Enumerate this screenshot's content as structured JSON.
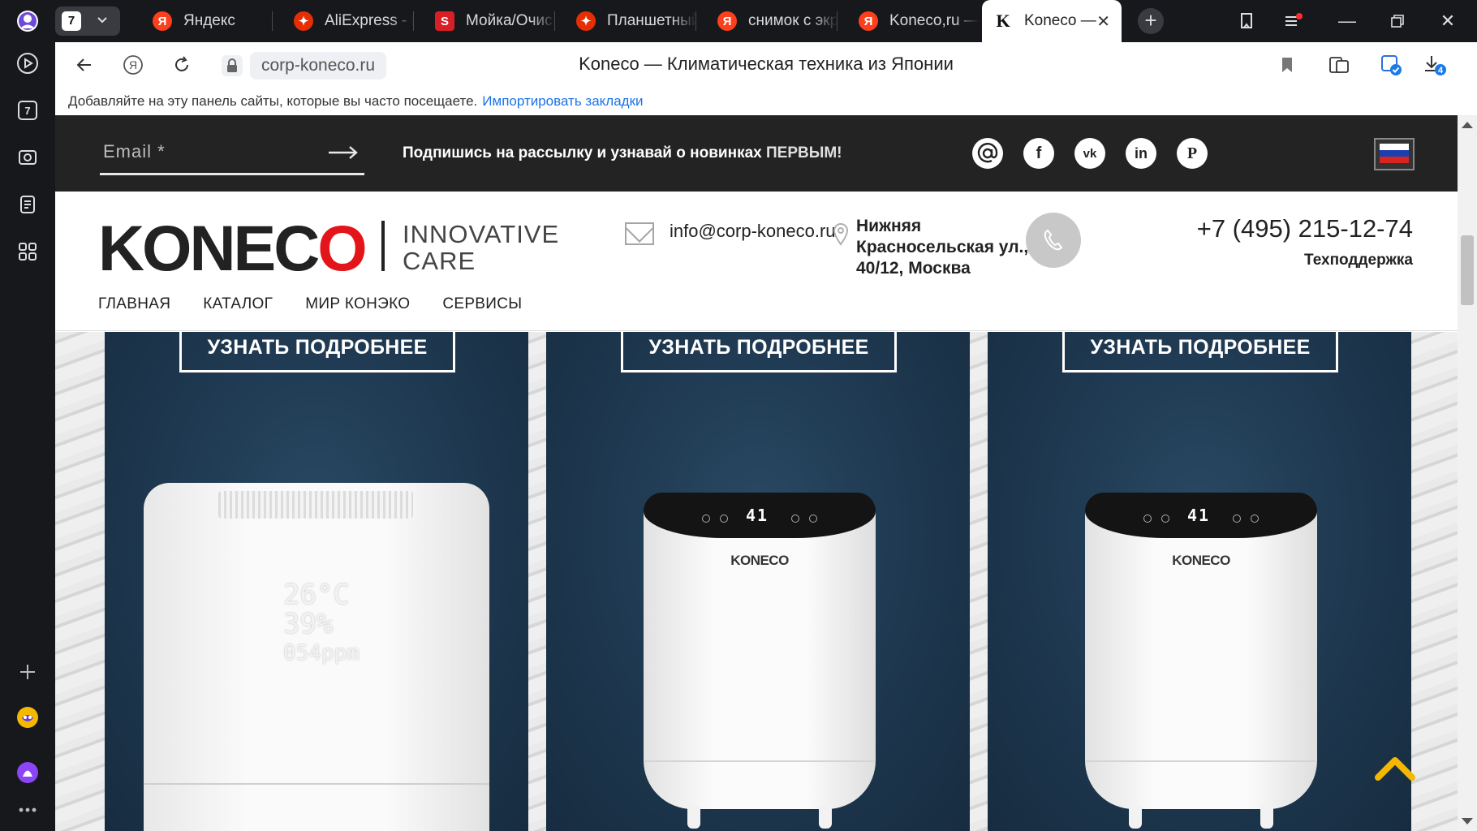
{
  "browser": {
    "rail": {
      "tab_count_badge": "7",
      "items": [
        "profile-icon",
        "play-icon",
        "tab-counter-icon",
        "screenshot-icon",
        "collections-icon",
        "apps-grid-icon",
        "add-icon",
        "game-icon",
        "alice-icon",
        "more-icon"
      ]
    },
    "tabs": [
      {
        "label": "Яндекс",
        "favicon": "Я",
        "color": "#fc3f1d"
      },
      {
        "label": "AliExpress - и",
        "favicon": "✦",
        "color": "#e62e04"
      },
      {
        "label": "Мойка/Очис",
        "favicon": "S",
        "color": "#d91f26"
      },
      {
        "label": "Планшетный",
        "favicon": "✦",
        "color": "#e62e04"
      },
      {
        "label": "снимок с экр",
        "favicon": "Я",
        "color": "#fc3f1d"
      },
      {
        "label": "Koneco,ru —",
        "favicon": "Я",
        "color": "#fc3f1d"
      },
      {
        "label": "Koneco —",
        "favicon": "K",
        "color": "#222222",
        "active": true
      }
    ],
    "tab_group_count": "7",
    "address": {
      "url": "corp-koneco.ru",
      "page_title": "Koneco — Климатическая техника из Японии",
      "download_badge": "4"
    },
    "bookmarks_bar": {
      "text": "Добавляйте на эту панель сайты, которые вы часто посещаете.",
      "link": "Импортировать закладки"
    }
  },
  "site": {
    "newsletter": {
      "email_placeholder": "Email *",
      "text": "Подпишись на рассылку и узнавай о новинках",
      "highlight": "ПЕРВЫМ!",
      "social": [
        "@",
        "f",
        "vk",
        "in",
        "P"
      ],
      "flag_colors": [
        "#ffffff",
        "#1c3fb0",
        "#d8261f"
      ]
    },
    "header": {
      "logo_text": "KONEC",
      "logo_o": "O",
      "tagline_1": "INNOVATIVE",
      "tagline_2": "CARE",
      "email": "info@corp-koneco.ru",
      "address_1": "Нижняя",
      "address_2": "Красносельская ул.,",
      "address_3": "40/12, Москва",
      "phone": "+7 (495) 215-12-74",
      "support": "Техподдержка",
      "menu": [
        "ГЛАВНАЯ",
        "КАТАЛОГ",
        "МИР КОНЭКО",
        "СЕРВИСЫ"
      ]
    },
    "products": [
      {
        "button": "УЗНАТЬ ПОДРОБНЕЕ",
        "display": [
          "26°C",
          "39%",
          "054ppm"
        ]
      },
      {
        "button": "УЗНАТЬ ПОДРОБНЕЕ",
        "digits": "41",
        "brand": "KONECO"
      },
      {
        "button": "УЗНАТЬ ПОДРОБНЕЕ",
        "digits": "41",
        "brand": "KONECO"
      }
    ],
    "accent_color": "#e3151a",
    "scroll_top_color": "#f5b800"
  }
}
